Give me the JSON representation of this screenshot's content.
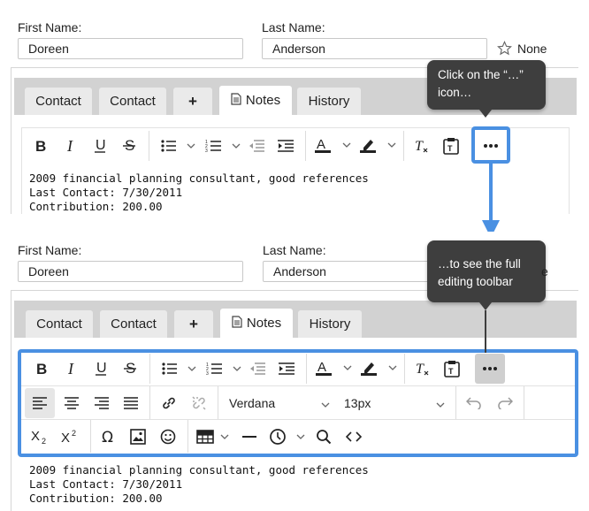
{
  "form": {
    "first_name_label": "First Name:",
    "first_name_value": "Doreen",
    "last_name_label": "Last Name:",
    "last_name_value": "Anderson",
    "rating_text": "None"
  },
  "tabs": [
    {
      "label": "Contact"
    },
    {
      "label": "Contact"
    },
    {
      "label": "+"
    },
    {
      "label": "Notes"
    },
    {
      "label": "History"
    }
  ],
  "toolbar": {
    "font_family": "Verdana",
    "font_size": "13px",
    "buttons_row1": [
      "bold-icon",
      "italic-icon",
      "underline-icon",
      "strikethrough-icon",
      "bullet-list-icon",
      "numbered-list-icon",
      "outdent-icon",
      "indent-icon",
      "text-color-icon",
      "highlight-color-icon",
      "clear-formatting-icon",
      "paste-text-icon",
      "more-icon"
    ],
    "buttons_row2": [
      "align-left-icon",
      "align-center-icon",
      "align-right-icon",
      "align-justify-icon",
      "link-icon",
      "unlink-icon",
      "undo-icon",
      "redo-icon"
    ],
    "buttons_row3": [
      "subscript-icon",
      "superscript-icon",
      "special-character-icon",
      "image-icon",
      "emoticon-icon",
      "table-icon",
      "horizontal-rule-icon",
      "datetime-icon",
      "search-replace-icon",
      "source-code-icon"
    ]
  },
  "notes": {
    "line1": "2009 financial planning consultant, good references",
    "line2": "Last Contact: 7/30/2011",
    "line3": "Contribution: 200.00"
  },
  "callouts": {
    "top": "Click on the “…” icon…",
    "bottom": "…to see the full editing toolbar"
  },
  "colors": {
    "highlight": "#4a90e2",
    "callout_bg": "#3e3e3e",
    "tabbar_bg": "#d2d2d2"
  }
}
